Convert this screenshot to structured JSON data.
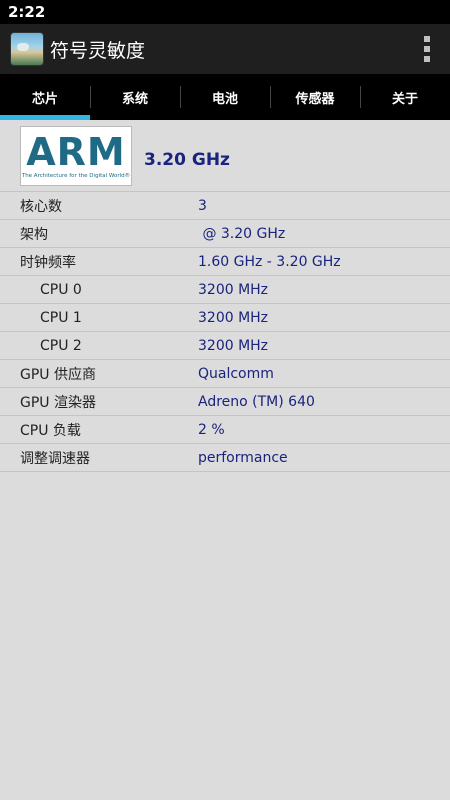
{
  "status_bar": {
    "time": "2:22"
  },
  "app_bar": {
    "title": "符号灵敏度"
  },
  "tabs": [
    {
      "label": "芯片",
      "active": true
    },
    {
      "label": "系统",
      "active": false
    },
    {
      "label": "电池",
      "active": false
    },
    {
      "label": "传感器",
      "active": false
    },
    {
      "label": "关于",
      "active": false
    }
  ],
  "soc": {
    "logo_text": "ARM",
    "logo_tagline": "The Architecture for the Digital World®",
    "frequency": "3.20 GHz"
  },
  "rows": [
    {
      "label": "核心数",
      "value": "3"
    },
    {
      "label": "架构",
      "value": " @ 3.20 GHz"
    },
    {
      "label": "时钟频率",
      "value": "1.60 GHz - 3.20 GHz"
    },
    {
      "label": "CPU 0",
      "value": "3200 MHz"
    },
    {
      "label": "CPU 1",
      "value": "3200 MHz"
    },
    {
      "label": "CPU 2",
      "value": "3200 MHz"
    },
    {
      "label": "GPU 供应商",
      "value": "Qualcomm"
    },
    {
      "label": "GPU 渲染器",
      "value": "Adreno (TM) 640"
    },
    {
      "label": "CPU 负载",
      "value": "2 %"
    },
    {
      "label": "调整调速器",
      "value": "performance"
    }
  ],
  "colors": {
    "accent": "#33b5e5",
    "value_text": "#1a237e",
    "background": "#dcdcdc"
  },
  "icons": {
    "app": "landscape-app-icon",
    "menu": "overflow-menu-icon"
  }
}
